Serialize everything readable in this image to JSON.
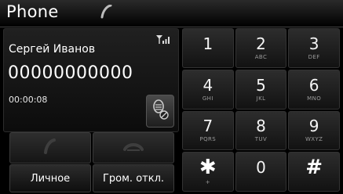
{
  "header": {
    "title": "Phone",
    "icon": "handset-icon"
  },
  "call": {
    "contact_name": "Сергей Иванов",
    "number": "00000000000",
    "duration": "00:00:08"
  },
  "buttons": {
    "private_label": "Личное",
    "mute_label": "Гром. откл."
  },
  "keypad": [
    {
      "digit": "1",
      "letters": ""
    },
    {
      "digit": "2",
      "letters": "ABC"
    },
    {
      "digit": "3",
      "letters": "DEF"
    },
    {
      "digit": "4",
      "letters": "GHI"
    },
    {
      "digit": "5",
      "letters": "JKL"
    },
    {
      "digit": "6",
      "letters": "MNO"
    },
    {
      "digit": "7",
      "letters": "PQRS"
    },
    {
      "digit": "8",
      "letters": "TUV"
    },
    {
      "digit": "9",
      "letters": "WXYZ"
    },
    {
      "digit": "✱",
      "letters": "+"
    },
    {
      "digit": "0",
      "letters": ""
    },
    {
      "digit": "#",
      "letters": ""
    }
  ]
}
